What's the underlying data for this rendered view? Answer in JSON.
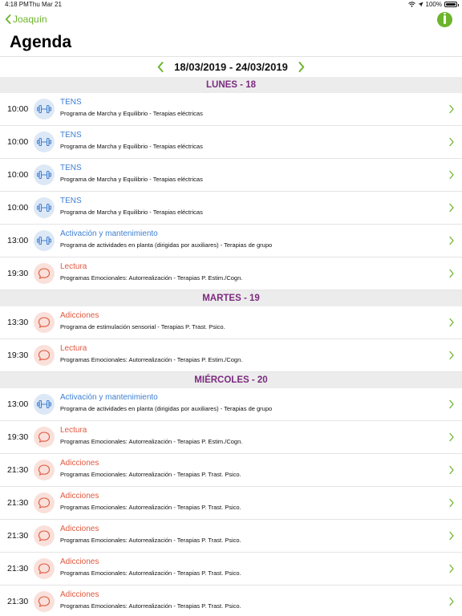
{
  "status": {
    "time": "4:18 PM",
    "date": "Thu Mar 21",
    "battery": "100%",
    "battery_level": 1.0
  },
  "nav": {
    "back_label": "Joaquín"
  },
  "page": {
    "title": "Agenda"
  },
  "week": {
    "range": "18/03/2019 - 24/03/2019"
  },
  "colors": {
    "accent": "#6cb42c",
    "day_header": "#7b2b7f",
    "blue_title": "#3d7fd0",
    "red_title": "#e0583f",
    "blue_icon_bg": "#dde8f6",
    "red_icon_bg": "#fae0da"
  },
  "days": [
    {
      "label": "LUNES - 18",
      "items": [
        {
          "time": "10:00",
          "icon": "dumbbell-icon",
          "kind": "blue",
          "title": "TENS",
          "subtitle": "Programa de Marcha y Equilibrio - Terapias eléctricas"
        },
        {
          "time": "10:00",
          "icon": "dumbbell-icon",
          "kind": "blue",
          "title": "TENS",
          "subtitle": "Programa de Marcha y Equilibrio - Terapias eléctricas"
        },
        {
          "time": "10:00",
          "icon": "dumbbell-icon",
          "kind": "blue",
          "title": "TENS",
          "subtitle": "Programa de Marcha y Equilibrio - Terapias eléctricas"
        },
        {
          "time": "10:00",
          "icon": "dumbbell-icon",
          "kind": "blue",
          "title": "TENS",
          "subtitle": "Programa de Marcha y Equilibrio - Terapias eléctricas"
        },
        {
          "time": "13:00",
          "icon": "dumbbell-icon",
          "kind": "blue",
          "title": "Activación y mantenimiento",
          "subtitle": "Programa de actividades en planta (dirigidas por auxiliares) - Terapias de grupo"
        },
        {
          "time": "19:30",
          "icon": "chat-bubble-icon",
          "kind": "red",
          "title": "Lectura",
          "subtitle": "Programas Emocionales: Autorrealización - Terapias P. Estim./Cogn."
        }
      ]
    },
    {
      "label": "MARTES - 19",
      "items": [
        {
          "time": "13:30",
          "icon": "chat-bubble-icon",
          "kind": "red",
          "title": "Adicciones",
          "subtitle": "Programa de estimulación sensorial - Terapias P. Trast. Psico."
        },
        {
          "time": "19:30",
          "icon": "chat-bubble-icon",
          "kind": "red",
          "title": "Lectura",
          "subtitle": "Programas Emocionales: Autorrealización - Terapias P. Estim./Cogn."
        }
      ]
    },
    {
      "label": "MIÉRCOLES - 20",
      "items": [
        {
          "time": "13:00",
          "icon": "dumbbell-icon",
          "kind": "blue",
          "title": "Activación y mantenimiento",
          "subtitle": "Programa de actividades en planta (dirigidas por auxiliares) - Terapias de grupo"
        },
        {
          "time": "19:30",
          "icon": "chat-bubble-icon",
          "kind": "red",
          "title": "Lectura",
          "subtitle": "Programas Emocionales: Autorrealización - Terapias P. Estim./Cogn."
        },
        {
          "time": "21:30",
          "icon": "chat-bubble-icon",
          "kind": "red",
          "title": "Adicciones",
          "subtitle": "Programas Emocionales: Autorrealización - Terapias P. Trast. Psico."
        },
        {
          "time": "21:30",
          "icon": "chat-bubble-icon",
          "kind": "red",
          "title": "Adicciones",
          "subtitle": "Programas Emocionales: Autorrealización - Terapias P. Trast. Psico."
        },
        {
          "time": "21:30",
          "icon": "chat-bubble-icon",
          "kind": "red",
          "title": "Adicciones",
          "subtitle": "Programas Emocionales: Autorrealización - Terapias P. Trast. Psico."
        },
        {
          "time": "21:30",
          "icon": "chat-bubble-icon",
          "kind": "red",
          "title": "Adicciones",
          "subtitle": "Programas Emocionales: Autorrealización - Terapias P. Trast. Psico."
        },
        {
          "time": "21:30",
          "icon": "chat-bubble-icon",
          "kind": "red",
          "title": "Adicciones",
          "subtitle": "Programas Emocionales: Autorrealización - Terapias P. Trast. Psico."
        }
      ]
    }
  ]
}
